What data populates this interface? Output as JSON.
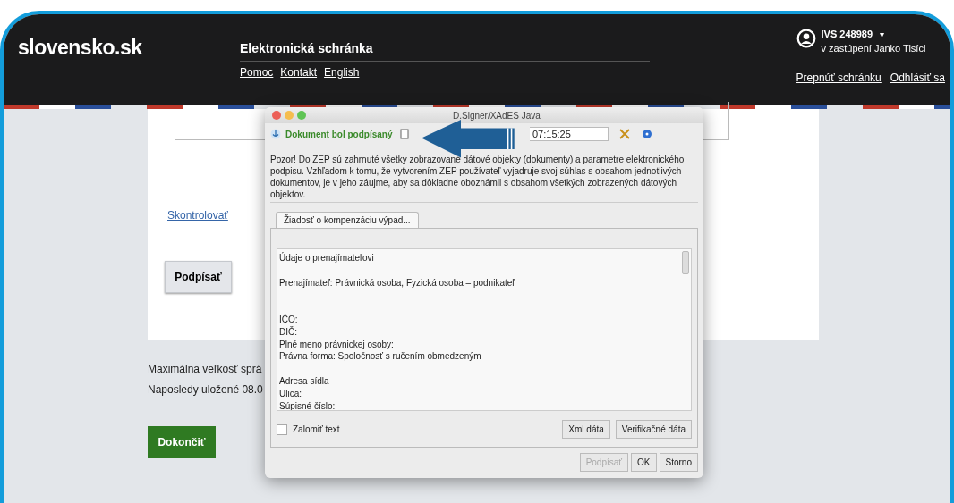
{
  "header": {
    "logo": "slovensko.sk",
    "title": "Elektronická schránka",
    "links": [
      "Pomoc",
      "Kontakt",
      "English"
    ],
    "account": "IVS 248989",
    "caret": "▾",
    "representation": "v zastúpení Janko Tisíci",
    "account_links": [
      "Prepnúť schránku",
      "Odhlásiť sa"
    ]
  },
  "form": {
    "check_link": "Skontrolovať",
    "sign_button": "Podpísať",
    "notes": [
      "Maximálna veľkosť sprá",
      "Naposledy uložené 08.0"
    ],
    "finish_button": "Dokončiť"
  },
  "dialog": {
    "title": "D.Signer/XAdES Java",
    "status": "Dokument bol podpísaný",
    "time": "07:15:25",
    "warning": "Pozor! Do ZEP sú zahrnuté všetky zobrazované dátové objekty (dokumenty) a parametre elektronického podpisu. Vzhľadom k tomu, že vytvorením ZEP používateľ vyjadruje svoj súhlas s obsahom jednotlivých dokumentov, je v jeho záujme, aby sa dôkladne oboznámil s obsahom všetkých zobrazených dátových objektov.",
    "tabs": [
      {
        "label": "Žiadosť o kompenzáciu výpad...",
        "selected": true
      }
    ],
    "content_blocks": [
      {
        "lines": [
          "Údaje o prenajímateľovi"
        ]
      },
      {
        "lines": [
          "Prenajímateľ: Právnická osoba, Fyzická osoba – podnikateľ"
        ]
      },
      {
        "lines": [
          "IČO:",
          "DIČ:",
          "Plné meno právnickej osoby:",
          "Právna forma: Spoločnosť s ručením obmedzeným"
        ]
      },
      {
        "lines": [
          "Adresa sídla",
          "Ulica:",
          "Súpisné číslo:"
        ]
      }
    ],
    "wrap": {
      "label": "Zalomiť text",
      "checked": false
    },
    "data_buttons": [
      "Xml dáta",
      "Verifikačné dáta"
    ],
    "buttons": [
      {
        "label": "Podpísať",
        "disabled": true
      },
      {
        "label": "OK",
        "disabled": false
      },
      {
        "label": "Storno",
        "disabled": false
      }
    ]
  }
}
